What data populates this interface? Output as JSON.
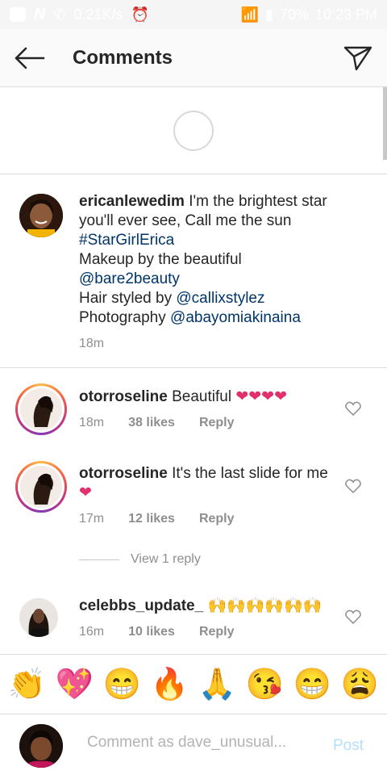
{
  "status_bar": {
    "network_speed": "0.21K/s",
    "battery": "70%",
    "time": "10:23 PM"
  },
  "header": {
    "title": "Comments"
  },
  "caption": {
    "username": "ericanlewedim",
    "line1": "I'm the brightest star you'll ever see, Call me the sun",
    "hashtag": "#StarGirlErica",
    "makeup_prefix": "Makeup by the beautiful",
    "makeup_handle": "@bare2beauty",
    "hair_prefix": "Hair styled by",
    "hair_handle": "@callixstylez",
    "photo_prefix": "Photography",
    "photo_handle": "@abayomiakinaina",
    "time": "18m"
  },
  "comments": [
    {
      "username": "otorroseline",
      "text": "Beautiful",
      "emoji": "❤❤❤❤",
      "time": "18m",
      "likes": "38 likes",
      "reply": "Reply"
    },
    {
      "username": "otorroseline",
      "text": "It's the last slide for me",
      "emoji": "❤",
      "time": "17m",
      "likes": "12 likes",
      "reply": "Reply"
    },
    {
      "username": "celebbs_update_",
      "text": "",
      "emoji": "🙌🙌🙌🙌🙌🙌",
      "time": "16m",
      "likes": "10 likes",
      "reply": "Reply"
    }
  ],
  "view_replies": "View 1 reply",
  "emoji_bar": [
    "👏",
    "💖",
    "😁",
    "🔥",
    "🙏",
    "😘",
    "😁",
    "😩"
  ],
  "composer": {
    "placeholder": "Comment as dave_unusual...",
    "post_label": "Post"
  },
  "colors": {
    "link": "#003569",
    "muted": "#8e8e8e",
    "post_disabled": "#b2dffc",
    "heart": "#e1306c"
  }
}
